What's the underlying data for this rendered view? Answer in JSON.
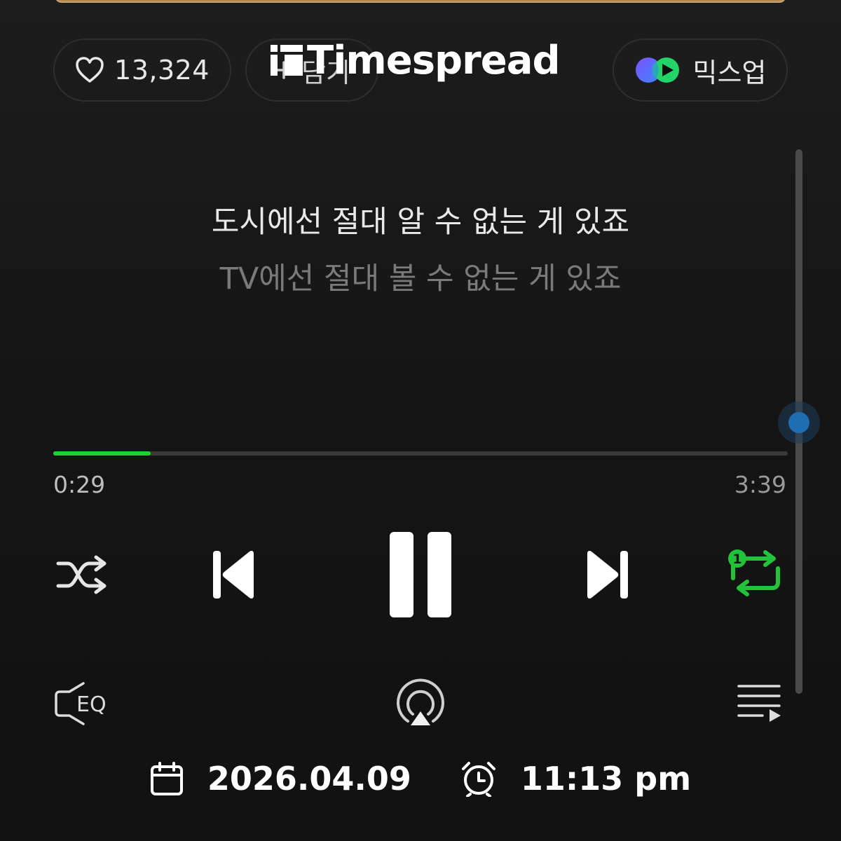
{
  "header": {
    "like_count": "13,324",
    "save_label": "담기",
    "mixup_label": "믹스업"
  },
  "watermark": {
    "brand": "Timespread"
  },
  "lyrics": {
    "current_line": "도시에선 절대 알 수 없는 게 있죠",
    "next_line": "TV에선 절대 볼 수 없는 게 있죠"
  },
  "playback": {
    "elapsed": "0:29",
    "total": "3:39",
    "progress_fraction": 0.1324,
    "accent_color": "#1ed22b",
    "repeat_badge": "1"
  },
  "controls": {
    "shuffle_icon": "shuffle-icon",
    "previous_icon": "previous-icon",
    "pause_icon": "pause-icon",
    "next_icon": "next-icon",
    "repeat_icon": "repeat-one-icon"
  },
  "bottom_tools": {
    "eq_label": "EQ",
    "airplay_icon": "airplay-icon",
    "playlist_icon": "playlist-icon"
  },
  "footer": {
    "date": "2026.04.09",
    "time": "11:13 pm"
  }
}
